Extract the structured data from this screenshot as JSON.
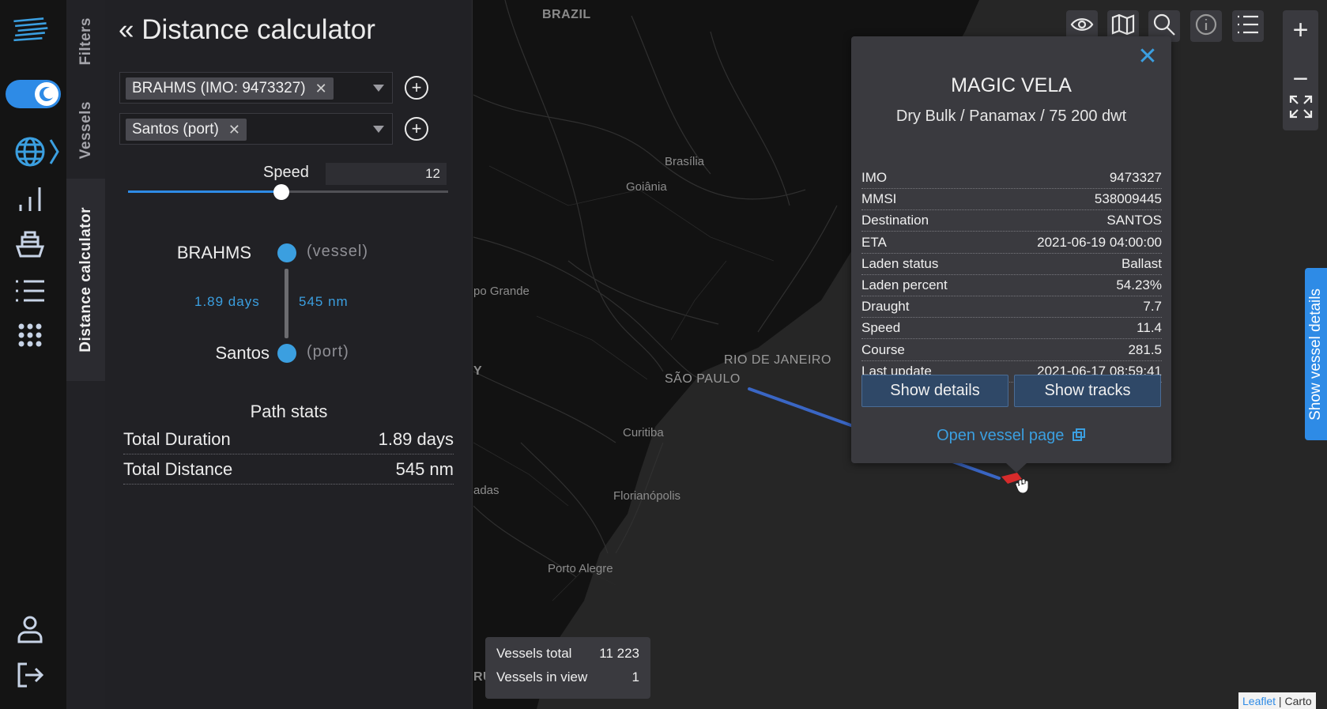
{
  "sidebar": {
    "tabs": [
      {
        "id": "filters",
        "label": "Filters",
        "active": false
      },
      {
        "id": "vessels",
        "label": "Vessels",
        "active": false
      },
      {
        "id": "distance",
        "label": "Distance calculator",
        "active": true
      }
    ]
  },
  "rail_icons": [
    "logo-icon",
    "theme-toggle",
    "globe-icon",
    "chart-icon",
    "ship-icon",
    "list-icon",
    "apps-icon",
    "user-icon",
    "logout-icon"
  ],
  "panel": {
    "title": "« Distance calculator",
    "from_chip": "BRAHMS (IMO: 9473327)",
    "to_chip": "Santos (port)",
    "speed_label": "Speed",
    "speed_value": "12",
    "speed_level": 0.48,
    "route": {
      "origin_name": "BRAHMS",
      "origin_type": "(vessel)",
      "leg_duration": "1.89 days",
      "leg_distance": "545 nm",
      "dest_name": "Santos",
      "dest_type": "(port)"
    },
    "stats_title": "Path stats",
    "stats": [
      {
        "label": "Total Duration",
        "value": "1.89 days"
      },
      {
        "label": "Total Distance",
        "value": "545 nm"
      }
    ]
  },
  "map": {
    "labels": {
      "brazil": "BRAZIL",
      "brasilia": "Brasília",
      "goiania": "Goiânia",
      "campo_grande": "po Grande",
      "rio": "RIO DE JANEIRO",
      "sao_paulo": "SÃO PAULO",
      "py": "Y",
      "curitiba": "Curitiba",
      "florianopolis": "Florianópolis",
      "adas": "adas",
      "porto_alegre": "Porto Alegre",
      "ru": "RU"
    },
    "toolbar_icons": [
      "eye-icon",
      "map-icon",
      "search-icon",
      "info-icon",
      "list-icon"
    ],
    "zoom_in": "+",
    "zoom_out": "−",
    "counters": [
      {
        "label": "Vessels total",
        "value": "11 223"
      },
      {
        "label": "Vessels in view",
        "value": "1"
      }
    ],
    "side_tab": "Show vessel details",
    "attribution_leaflet": "Leaflet",
    "attribution_sep": " | ",
    "attribution_carto": "Carto",
    "colors": {
      "accent": "#2e8be6",
      "route": "#3a66c4",
      "vessel": "#d62b2b"
    }
  },
  "popup": {
    "title": "MAGIC VELA",
    "subtitle": "Dry Bulk / Panamax / 75 200 dwt",
    "rows": [
      {
        "label": "IMO",
        "value": "9473327"
      },
      {
        "label": "MMSI",
        "value": "538009445"
      },
      {
        "label": "Destination",
        "value": "SANTOS"
      },
      {
        "label": "ETA",
        "value": "2021-06-19 04:00:00"
      },
      {
        "label": "Laden status",
        "value": "Ballast"
      },
      {
        "label": "Laden percent",
        "value": "54.23%"
      },
      {
        "label": "Draught",
        "value": "7.7"
      },
      {
        "label": "Speed",
        "value": "11.4"
      },
      {
        "label": "Course",
        "value": "281.5"
      },
      {
        "label": "Last update",
        "value": "2021-06-17 08:59:41"
      }
    ],
    "show_details": "Show details",
    "show_tracks": "Show tracks",
    "open_link": "Open vessel page"
  }
}
